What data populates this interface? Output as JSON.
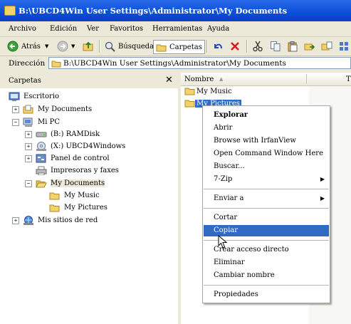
{
  "window": {
    "title": "B:\\UBCD4Win User Settings\\Administrator\\My Documents"
  },
  "menu": [
    "Archivo",
    "Edición",
    "Ver",
    "Favoritos",
    "Herramientas",
    "Ayuda"
  ],
  "toolbar": {
    "back_label": "Atrás",
    "search_label": "Búsqueda",
    "folders_label": "Carpetas"
  },
  "address": {
    "label": "Dirección",
    "value": "B:\\UBCD4Win User Settings\\Administrator\\My Documents"
  },
  "folders_pane": {
    "title": "Carpetas",
    "tree": [
      {
        "label": "Escritorio",
        "icon": "desktop-icon"
      },
      {
        "label": "My Documents",
        "icon": "documents-icon"
      },
      {
        "label": "Mi PC",
        "icon": "computer-icon"
      },
      {
        "label": "(B:) RAMDisk",
        "icon": "drive-icon"
      },
      {
        "label": "(X:) UBCD4Windows",
        "icon": "cd-drive-icon"
      },
      {
        "label": "Panel de control",
        "icon": "control-panel-icon"
      },
      {
        "label": "Impresoras y faxes",
        "icon": "printer-icon"
      },
      {
        "label": "My Documents",
        "icon": "folder-open-icon"
      },
      {
        "label": "My Music",
        "icon": "folder-icon"
      },
      {
        "label": "My Pictures",
        "icon": "folder-icon"
      },
      {
        "label": "Mis sitios de red",
        "icon": "network-icon"
      }
    ]
  },
  "file_list": {
    "column_name": "Nombre",
    "column_next": "T",
    "items": [
      {
        "name": "My Music",
        "icon": "folder-icon"
      },
      {
        "name": "My Pictures",
        "icon": "folder-icon"
      }
    ]
  },
  "context_menu": {
    "items": [
      "Explorar",
      "Abrir",
      "Browse with IrfanView",
      "Open Command Window Here",
      "Buscar...",
      "7-Zip",
      "Enviar a",
      "Cortar",
      "Copiar",
      "Crear acceso directo",
      "Eliminar",
      "Cambiar nombre",
      "Propiedades"
    ],
    "highlighted": "Copiar",
    "highlight_color": "#316ac5"
  },
  "colors": {
    "titlebar": "#0a4ed8",
    "chrome": "#ece9d8",
    "selection": "#316ac5"
  }
}
